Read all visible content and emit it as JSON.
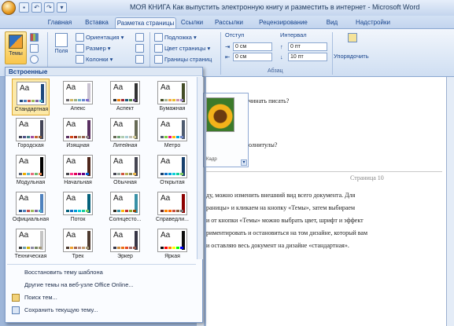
{
  "window": {
    "title": "МОЯ КНИГА Как выпустить электронную книгу и разместить в интернет - Microsoft Word",
    "qat": [
      "save-icon",
      "undo-icon",
      "redo-icon",
      "customize-icon"
    ]
  },
  "tabs": [
    {
      "label": "Главная",
      "active": false
    },
    {
      "label": "Вставка",
      "active": false
    },
    {
      "label": "Разметка страницы",
      "active": true
    },
    {
      "label": "Ссылки",
      "active": false
    },
    {
      "label": "Рассылки",
      "active": false
    },
    {
      "label": "Рецензирование",
      "active": false
    },
    {
      "label": "Вид",
      "active": false
    },
    {
      "label": "Надстройки",
      "active": false
    }
  ],
  "ribbon": {
    "themes_label": "Темы",
    "fields_label": "Поля",
    "orientation": "Ориентация",
    "size": "Размер",
    "columns": "Колонки",
    "watermark": "Подложка",
    "page_color": "Цвет страницы",
    "page_borders": "Границы страниц",
    "indent_label": "Отступ",
    "spacing_label": "Интервал",
    "indent_left": "0 см",
    "indent_right": "0 см",
    "spacing_before": "0 пт",
    "spacing_after": "10 пт",
    "paragraph_group": "Абзац",
    "arrange": "Упорядочить"
  },
  "dropdown": {
    "header": "Встроенные",
    "themes": [
      {
        "name": "Стандартная",
        "selected": true,
        "colors": [
          "#1f497d",
          "#4f81bd",
          "#c0504d",
          "#9bbb59",
          "#8064a2",
          "#4bacc6"
        ],
        "stripe": "#1f497d"
      },
      {
        "name": "Апекс",
        "selected": false,
        "colors": [
          "#69676d",
          "#ceb966",
          "#9cb084",
          "#6bb1c9",
          "#6585cf",
          "#7e6bc9"
        ],
        "stripe": "#c9c2d1"
      },
      {
        "name": "Аспект",
        "selected": false,
        "colors": [
          "#323232",
          "#f07f09",
          "#9f2936",
          "#1b587c",
          "#4e8542",
          "#604878"
        ],
        "stripe": "#323232"
      },
      {
        "name": "Бумажная",
        "selected": false,
        "colors": [
          "#444d26",
          "#a5b592",
          "#f3a447",
          "#e7bc29",
          "#d092a7",
          "#9c85c0"
        ],
        "stripe": "#444d26"
      },
      {
        "name": "Городская",
        "selected": false,
        "colors": [
          "#424456",
          "#53548a",
          "#438086",
          "#a04da3",
          "#c4652d",
          "#8b5d3d"
        ],
        "stripe": "#424456"
      },
      {
        "name": "Изящная",
        "selected": false,
        "colors": [
          "#5a3061",
          "#d34817",
          "#9b2d1f",
          "#a28e6a",
          "#956251",
          "#918485"
        ],
        "stripe": "#5a3061"
      },
      {
        "name": "Литейная",
        "selected": false,
        "colors": [
          "#676a55",
          "#72a376",
          "#b0ccb0",
          "#a8cdd7",
          "#c0beaf",
          "#cec597"
        ],
        "stripe": "#676a55"
      },
      {
        "name": "Метро",
        "selected": false,
        "colors": [
          "#4e5b6f",
          "#7fd13b",
          "#ea157a",
          "#feb80a",
          "#00addc",
          "#738ac8"
        ],
        "stripe": "#4e5b6f"
      },
      {
        "name": "Модульная",
        "selected": false,
        "colors": [
          "#5a6378",
          "#f0ad00",
          "#60b5cc",
          "#e66c7d",
          "#6bb76d",
          "#e88651"
        ],
        "stripe": "#000000"
      },
      {
        "name": "Начальная",
        "selected": false,
        "colors": [
          "#46464a",
          "#ff388c",
          "#e40059",
          "#9c007f",
          "#68007f",
          "#005bd3"
        ],
        "stripe": "#4f271c"
      },
      {
        "name": "Обычная",
        "selected": false,
        "colors": [
          "#454551",
          "#93a299",
          "#cf543f",
          "#b5ae53",
          "#848058",
          "#e8b54d"
        ],
        "stripe": "#454551"
      },
      {
        "name": "Открытая",
        "selected": false,
        "colors": [
          "#17406d",
          "#0f6fc6",
          "#009dd9",
          "#0bd0d9",
          "#10cf9b",
          "#7cca62"
        ],
        "stripe": "#17406d"
      },
      {
        "name": "Официальная",
        "selected": false,
        "colors": [
          "#1f497d",
          "#4f81bd",
          "#c0504d",
          "#9bbb59",
          "#8064a2",
          "#4bacc6"
        ],
        "stripe": "#4f81bd"
      },
      {
        "name": "Поток",
        "selected": false,
        "colors": [
          "#04617b",
          "#0f6fc6",
          "#009dd9",
          "#0bd0d9",
          "#10cf9b",
          "#7cca62"
        ],
        "stripe": "#04617b"
      },
      {
        "name": "Солнцесто...",
        "selected": false,
        "colors": [
          "#2f2b20",
          "#3891a7",
          "#feb80a",
          "#c32d2e",
          "#84aa33",
          "#964305"
        ],
        "stripe": "#3891a7"
      },
      {
        "name": "Справедли...",
        "selected": false,
        "colors": [
          "#632423",
          "#ff8600",
          "#ff6600",
          "#c74b3a",
          "#8d5c3c",
          "#787878"
        ],
        "stripe": "#8d0000"
      },
      {
        "name": "Техническая",
        "selected": false,
        "colors": [
          "#3b3b3b",
          "#6ea0b0",
          "#ccaf0a",
          "#8d89a4",
          "#748560",
          "#9e9273"
        ],
        "stripe": "#c4c4c4"
      },
      {
        "name": "Трек",
        "selected": false,
        "colors": [
          "#4e3b30",
          "#f0a22e",
          "#a5644e",
          "#b58b80",
          "#c3986d",
          "#a19574"
        ],
        "stripe": "#4e3b30"
      },
      {
        "name": "Эркер",
        "selected": false,
        "colors": [
          "#373545",
          "#ce8d3e",
          "#ec7016",
          "#e64823",
          "#9c6a6a",
          "#9b5b4c"
        ],
        "stripe": "#373545"
      },
      {
        "name": "Яркая",
        "selected": false,
        "colors": [
          "#0c0c0c",
          "#ff0000",
          "#ff8000",
          "#ffff00",
          "#00ff00",
          "#0000ff"
        ],
        "stripe": "#0c0c0c"
      }
    ],
    "menu": [
      {
        "label": "Восстановить тему шаблона",
        "icon": ""
      },
      {
        "label": "Другие темы на веб-узле Office Online...",
        "icon": ""
      },
      {
        "label": "Поиск тем...",
        "icon": "folder-icon"
      },
      {
        "label": "Сохранить текущую тему...",
        "icon": "save-theme-icon"
      }
    ]
  },
  "document": {
    "line1": "чинать писать?",
    "line2": "олнитулы?",
    "kadr": "Кадр",
    "page_number": "Страница 10",
    "para": [
      "ду, можно изменить внешний вид всего документа. Для",
      "раницы» и кликаем на кнопку «Темы», затем выбираем",
      "и от кнопки «Темы» можно выбрать цвет, шрифт и эффект",
      "риментировать и остановиться на том дизайне, который вам",
      "и оставляю весь документ на дизайне «стандартная»."
    ]
  }
}
